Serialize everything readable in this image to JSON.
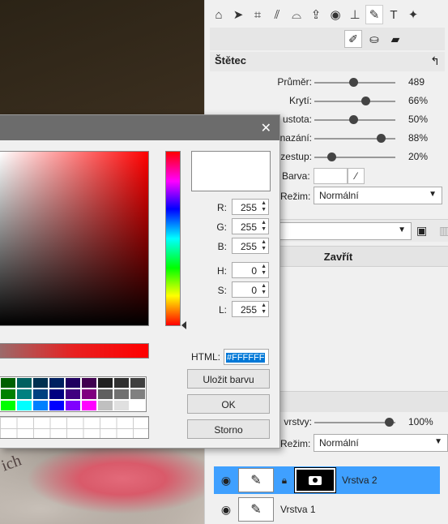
{
  "toolbar": {
    "tools": [
      "home-icon",
      "pointer-icon",
      "crop-icon",
      "perspective-icon",
      "lasso-icon",
      "upload-icon",
      "eye-icon",
      "stamp-icon",
      "brush-bucket-icon",
      "text-icon",
      "magic-icon"
    ],
    "subtools": [
      "brush-icon",
      "bucket-icon",
      "eraser-icon"
    ]
  },
  "brush_panel": {
    "title": "Štětec",
    "sliders": [
      {
        "label": "Průměr:",
        "value": "489",
        "fraction": 0.48
      },
      {
        "label": "Krytí:",
        "value": "66%",
        "fraction": 0.63
      },
      {
        "label": "ustota:",
        "value": "50%",
        "fraction": 0.48
      },
      {
        "label": "nazání:",
        "value": "88%",
        "fraction": 0.82
      },
      {
        "label": "zestup:",
        "value": "20%",
        "fraction": 0.21
      }
    ],
    "color_label": "Barva:",
    "color_value": "#FFFFFF",
    "mode_label": "Režim:",
    "mode_value": "Normální"
  },
  "close_bar": {
    "label": "Zavřít"
  },
  "layers_panel": {
    "opacity_label": "vrstvy:",
    "opacity_value": "100%",
    "opacity_fraction": 0.92,
    "mode_label": "Režim:",
    "mode_value": "Normální",
    "layers": [
      {
        "name": "Vrstva 2",
        "selected": true
      },
      {
        "name": "Vrstva 1",
        "selected": false
      }
    ]
  },
  "color_dialog": {
    "close_symbol": "✕",
    "fields": [
      {
        "label": "R:",
        "value": "255"
      },
      {
        "label": "G:",
        "value": "255"
      },
      {
        "label": "B:",
        "value": "255"
      },
      {
        "label": "H:",
        "value": "0"
      },
      {
        "label": "S:",
        "value": "0"
      },
      {
        "label": "L:",
        "value": "255"
      }
    ],
    "html_label": "HTML:",
    "html_value": "#FFFFFF",
    "save_color_label": "Uložit barvu",
    "ok_label": "OK",
    "cancel_label": "Storno",
    "palette": [
      "#006000",
      "#006060",
      "#003050",
      "#002060",
      "#200060",
      "#400050",
      "#202020",
      "#303030",
      "#404040",
      "#008000",
      "#008080",
      "#004080",
      "#000080",
      "#400080",
      "#800080",
      "#606060",
      "#707070",
      "#808080",
      "#00ff00",
      "#00ffff",
      "#0080ff",
      "#0000ff",
      "#8000ff",
      "#ff00ff",
      "#c0c0c0",
      "#e0e0e0",
      "#ffffff"
    ]
  },
  "photo": {
    "text": "ich"
  }
}
